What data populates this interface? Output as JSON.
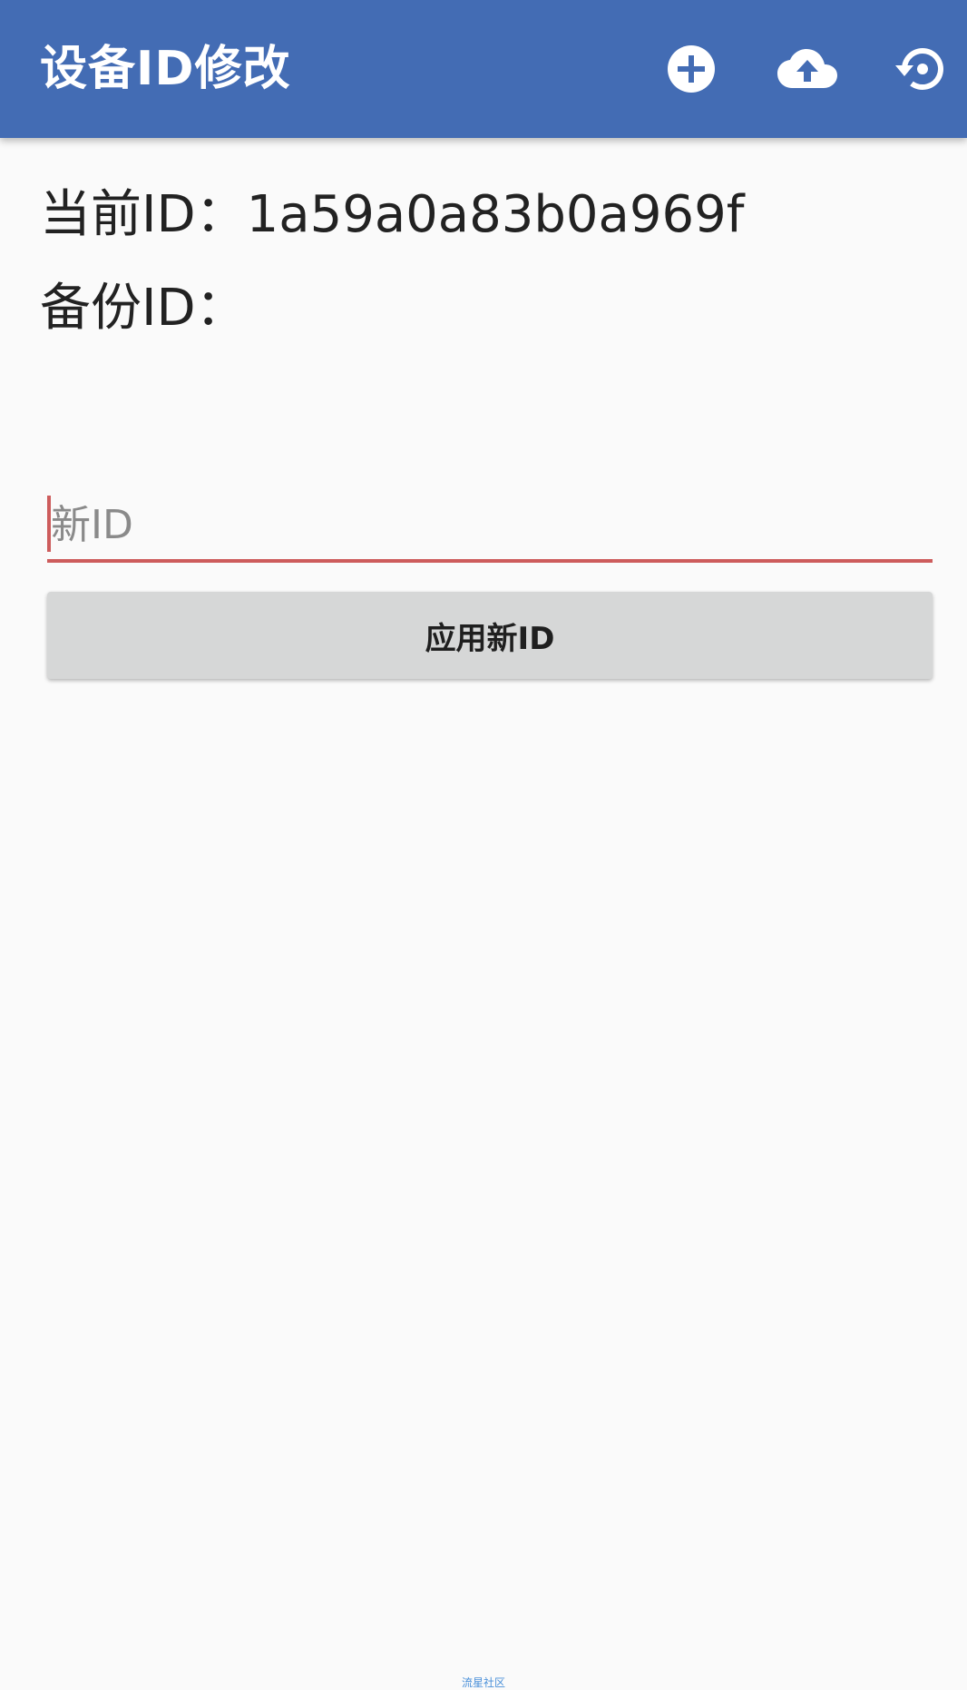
{
  "appbar": {
    "title": "设备ID修改",
    "background_color": "#436cb4",
    "actions": [
      {
        "icon": "add-circle-icon"
      },
      {
        "icon": "cloud-upload-icon"
      },
      {
        "icon": "restore-icon"
      }
    ]
  },
  "info": {
    "current_id_line": "当前ID：1a59a0a83b0a969f",
    "backup_id_line": "备份ID："
  },
  "new_id_input": {
    "value": "",
    "placeholder": "新ID",
    "accent_color": "#cd5c5c"
  },
  "apply_button": {
    "label": "应用新ID"
  },
  "watermark": {
    "text": "流星社区"
  }
}
